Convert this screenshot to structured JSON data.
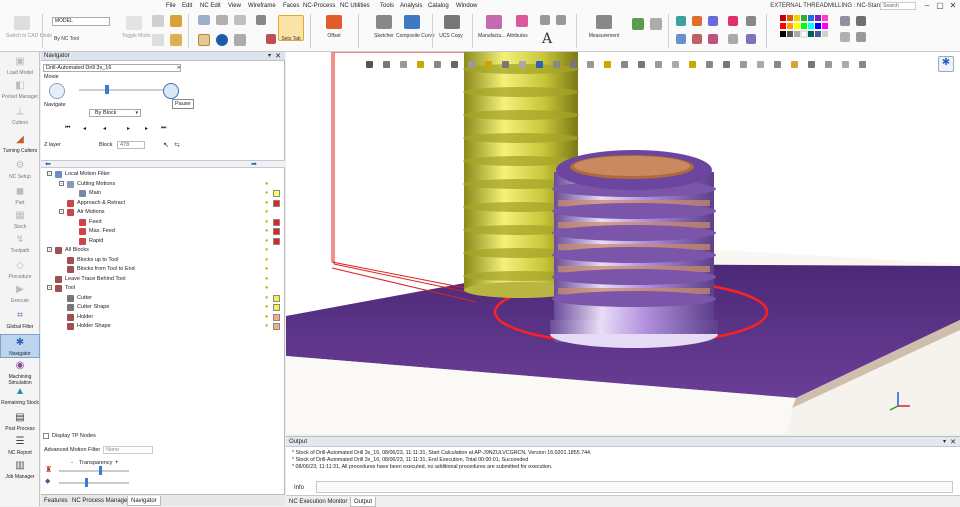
{
  "menu": [
    "File",
    "Edit",
    "NC Edit",
    "View",
    "Wireframe",
    "Faces",
    "NC-Process",
    "NC Utilities",
    "Tools",
    "Analysis",
    "Catalog",
    "Window"
  ],
  "window_title": "EXTERNAL THREADMILLING : NC-Standard",
  "search_label": "Search",
  "ribbon": {
    "switch_cad": "Switch to CAD Mode",
    "model_combo": "MODEL",
    "by_nc_tool": "By NC Tool",
    "toggle_motion": "Toggle Motio...",
    "sets_tab": "Sets Tab",
    "offset": "Offset",
    "sketcher": "Sketcher",
    "composite_curve": "Composite Curve",
    "ucs_copy": "UCS Copy",
    "manufacturing_attributes": "Manufactu... Attributes",
    "measurement": "Measurement"
  },
  "sidebar": [
    {
      "label": "Load Model",
      "icon": "folder-icon",
      "active": false
    },
    {
      "label": "Pocket Manager",
      "icon": "pocket-icon",
      "active": false
    },
    {
      "label": "Cutters",
      "icon": "cutter-icon",
      "active": false
    },
    {
      "label": "Turning Cutters",
      "icon": "turning-icon",
      "active": true
    },
    {
      "label": "NC Setup",
      "icon": "setup-icon",
      "active": false
    },
    {
      "label": "Part",
      "icon": "part-icon",
      "active": false
    },
    {
      "label": "Stock",
      "icon": "stock-icon",
      "active": false
    },
    {
      "label": "Toolpath",
      "icon": "toolpath-icon",
      "active": false
    },
    {
      "label": "Procedure",
      "icon": "procedure-icon",
      "active": false
    },
    {
      "label": "Execute",
      "icon": "execute-icon",
      "active": false
    },
    {
      "label": "Global Filter",
      "icon": "filter-icon",
      "active": true
    },
    {
      "label": "Navigator",
      "icon": "navigator-icon",
      "active": true,
      "selected": true
    },
    {
      "label": "Machining Simulation",
      "icon": "simulation-icon",
      "active": true
    },
    {
      "label": "Remaining Stock",
      "icon": "remaining-stock-icon",
      "active": true
    },
    {
      "label": "Post Process",
      "icon": "post-process-icon",
      "active": true
    },
    {
      "label": "NC Report",
      "icon": "report-icon",
      "active": true
    },
    {
      "label": "Job Manager",
      "icon": "job-manager-icon",
      "active": true
    }
  ],
  "navigator": {
    "title": "Navigator",
    "procedure": "Drill-Automated Drill 3x_16",
    "movie_label": "Movie",
    "navigate_label": "Navigate",
    "pause_tooltip": "Pause",
    "by_block": "By Block",
    "z_layer": "Z layer",
    "block_label": "Block",
    "block_value": "478"
  },
  "tree": [
    {
      "label": "Local Motion Filter",
      "level": 0,
      "expander": "-",
      "icon_color": "#6b8cc4",
      "bulb": false,
      "swatch": null
    },
    {
      "label": "Cutting Motions",
      "level": 1,
      "expander": "-",
      "icon_color": "#8899bb",
      "bulb": true,
      "swatch": null
    },
    {
      "label": "Main",
      "level": 2,
      "expander": null,
      "icon_color": "#7788aa",
      "bulb": true,
      "swatch": "#ffff66"
    },
    {
      "label": "Approach & Retract",
      "level": 1,
      "expander": null,
      "icon_color": "#c44",
      "bulb": true,
      "swatch": "#e22222"
    },
    {
      "label": "Air Motions",
      "level": 1,
      "expander": "-",
      "icon_color": "#c44",
      "bulb": true,
      "swatch": null
    },
    {
      "label": "Feed",
      "level": 2,
      "expander": null,
      "icon_color": "#c44",
      "bulb": true,
      "swatch": "#e22222"
    },
    {
      "label": "Max. Feed",
      "level": 2,
      "expander": null,
      "icon_color": "#c44",
      "bulb": true,
      "swatch": "#e22222"
    },
    {
      "label": "Rapid",
      "level": 2,
      "expander": null,
      "icon_color": "#c44",
      "bulb": true,
      "swatch": "#e22222"
    },
    {
      "label": "All Blocks",
      "level": 0,
      "expander": "-",
      "icon_color": "#a05050",
      "bulb": true,
      "swatch": null
    },
    {
      "label": "Blocks up to Tool",
      "level": 1,
      "expander": null,
      "icon_color": "#a05050",
      "bulb": true,
      "swatch": null
    },
    {
      "label": "Blocks from Tool to End",
      "level": 1,
      "expander": null,
      "icon_color": "#a05050",
      "bulb": true,
      "swatch": null
    },
    {
      "label": "Leave Trace Behind Tool",
      "level": 0,
      "expander": null,
      "icon_color": "#a05050",
      "bulb": true,
      "swatch": null
    },
    {
      "label": "Tool",
      "level": 0,
      "expander": "-",
      "icon_color": "#a05050",
      "bulb": true,
      "swatch": null
    },
    {
      "label": "Cutter",
      "level": 1,
      "expander": null,
      "icon_color": "#777",
      "bulb": true,
      "swatch": "#f2f24a"
    },
    {
      "label": "Cutter Shape",
      "level": 1,
      "expander": null,
      "icon_color": "#777",
      "bulb": true,
      "swatch": "#f2f24a"
    },
    {
      "label": "Holder",
      "level": 1,
      "expander": null,
      "icon_color": "#a05050",
      "bulb": true,
      "swatch": "#f4b07a"
    },
    {
      "label": "Holder Shape",
      "level": 1,
      "expander": null,
      "icon_color": "#a05050",
      "bulb": true,
      "swatch": "#f4b07a"
    }
  ],
  "bottom_options": {
    "display_tp_nodes": "Display TP Nodes",
    "advanced_motion_filter": "Advanced Motion Filter",
    "advanced_value": "None",
    "transparency": "Transparency"
  },
  "panel_tabs": [
    "Features",
    "NC Process Manager",
    "Navigator"
  ],
  "output": {
    "title": "Output",
    "lines": [
      "* Stock of Drill-Automated Drill 3x_16, 08/06/23, 11:11:31, Start Calculation at AP-J9NZULVCGRCN, Version 16.0201.1855.744.",
      "* Stock of Drill-Automated Drill 3x_16, 08/06/23, 11:11:31, End Execution, Total 00:00:01, Succeeded",
      "* 08/06/23, 11:11:31, All procedures have been executed, no additional procedures are submitted for execution."
    ],
    "info_tab": "Info",
    "tabs": [
      "NC Execution Monitor",
      "Output"
    ]
  },
  "colors": {
    "stock_purple": "#5b2f8c",
    "thread_yellow": "#d8d64a",
    "part_lavender": "#a27ad0",
    "toolpath_red": "#e02020"
  }
}
